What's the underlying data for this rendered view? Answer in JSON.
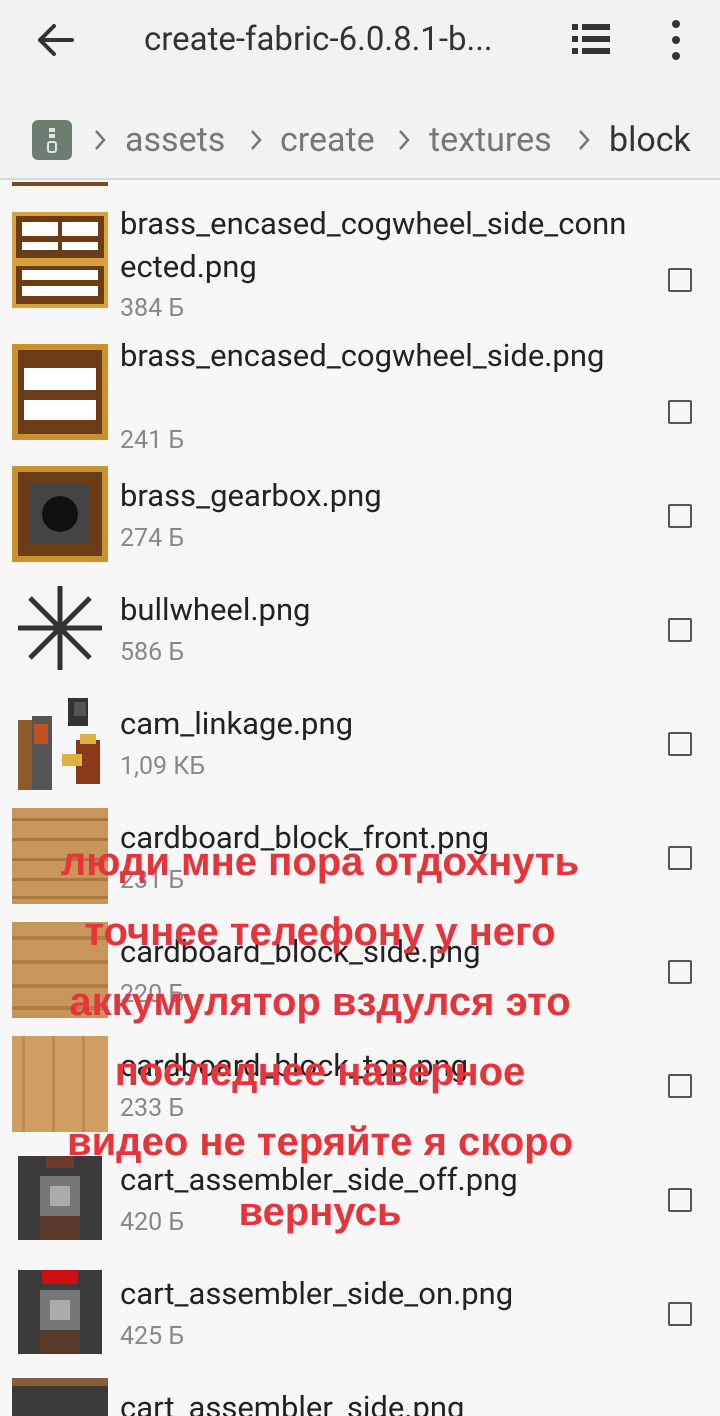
{
  "appbar": {
    "title": "create-fabric-6.0.8.1-b...",
    "back_icon": "arrow-back-icon",
    "view_icon": "list-view-icon",
    "more_icon": "more-vert-icon"
  },
  "breadcrumb": {
    "root_icon": "archive-icon",
    "items": [
      "assets",
      "create",
      "textures",
      "block"
    ]
  },
  "files": [
    {
      "name": "brass_encased_cogwheel_side_connected.png",
      "size": "384 Б"
    },
    {
      "name": "brass_encased_cogwheel_side.png",
      "size": "241 Б"
    },
    {
      "name": "brass_gearbox.png",
      "size": "274 Б"
    },
    {
      "name": "bullwheel.png",
      "size": "586 Б"
    },
    {
      "name": "cam_linkage.png",
      "size": "1,09 КБ"
    },
    {
      "name": "cardboard_block_front.png",
      "size": "231 Б"
    },
    {
      "name": "cardboard_block_side.png",
      "size": "220 Б"
    },
    {
      "name": "cardboard_block_top.png",
      "size": "233 Б"
    },
    {
      "name": "cart_assembler_side_off.png",
      "size": "420 Б"
    },
    {
      "name": "cart_assembler_side_on.png",
      "size": "425 Б"
    },
    {
      "name": "cart_assembler_side.png",
      "size": ""
    }
  ],
  "overlay_caption": [
    "люди мне пора отдохнуть",
    "точнее телефону у него",
    "аккумулятор вздулся это",
    "последнее наверное",
    "видео не теряйте я скоро",
    "вернусь"
  ],
  "colors": {
    "accent_overlay": "#e8333a",
    "appbar_bg": "#f2f2f2",
    "list_bg": "#f7f7f7"
  }
}
